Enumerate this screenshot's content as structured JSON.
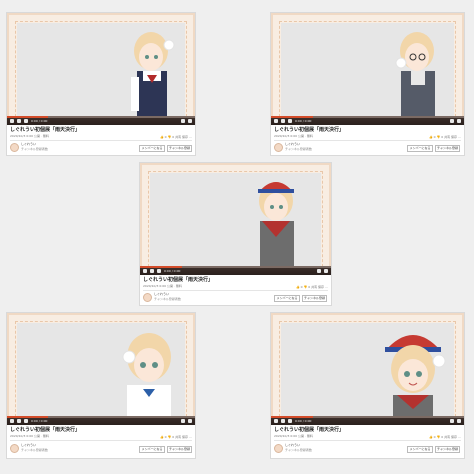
{
  "cards": [
    {
      "video_title": "しぐれうい初個展「雨天決行」",
      "meta": "2020/10/3 0:00 公開 · 無料",
      "stats": "👍 0  👎 0  共有  保存  …",
      "channel_name": "しぐれうい",
      "channel_sub": "チャンネル登録者数",
      "btn_join": "メンバーになる",
      "btn_subscribe": "チャンネル登録"
    },
    {
      "video_title": "しぐれうい初個展「雨天決行」",
      "meta": "2020/10/3 0:00 公開 · 無料",
      "stats": "👍 0  👎 0  共有  保存  …",
      "channel_name": "しぐれうい",
      "channel_sub": "チャンネル登録者数",
      "btn_join": "メンバーになる",
      "btn_subscribe": "チャンネル登録"
    },
    {
      "video_title": "しぐれうい初個展「雨天決行」",
      "meta": "2020/10/3 0:00 公開 · 無料",
      "stats": "👍 0  👎 0  共有  保存  …",
      "channel_name": "しぐれうい",
      "channel_sub": "チャンネル登録者数",
      "btn_join": "メンバーになる",
      "btn_subscribe": "チャンネル登録"
    },
    {
      "video_title": "しぐれうい初個展「雨天決行」",
      "meta": "2020/10/3 0:00 公開 · 無料",
      "stats": "👍 0  👎 0  共有  保存  …",
      "channel_name": "しぐれうい",
      "channel_sub": "チャンネル登録者数",
      "btn_join": "メンバーになる",
      "btn_subscribe": "チャンネル登録"
    },
    {
      "video_title": "しぐれうい初個展「雨天決行」",
      "meta": "2020/10/3 0:00 公開 · 無料",
      "stats": "👍 0  👎 0  共有  保存  …",
      "channel_name": "しぐれうい",
      "channel_sub": "チャンネル登録者数",
      "btn_join": "メンバーになる",
      "btn_subscribe": "チャンネル登録"
    }
  ],
  "player": {
    "time": "0:00 / 0:00",
    "progress_fraction": 0.22
  },
  "colors": {
    "accent_red": "#d34c2a",
    "frame_bg": "#f8ede2",
    "page_bg": "#efefef"
  }
}
